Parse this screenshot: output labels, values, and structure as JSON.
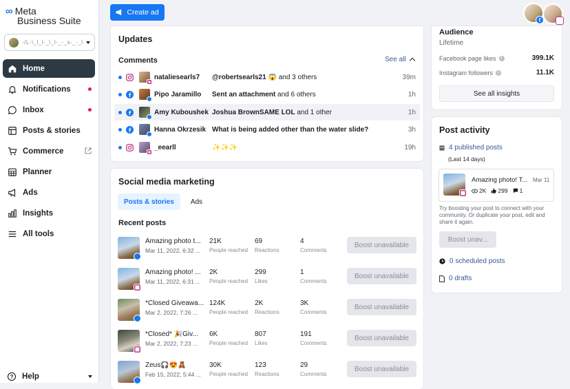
{
  "app": {
    "brand": "Meta",
    "product": "Business Suite"
  },
  "account": {
    "name": "-/L-\\_l_l-_\\_l-_-_s-_-_l-_l-_-_s"
  },
  "nav": {
    "items": [
      {
        "label": "Home",
        "icon": "home-icon",
        "active": true
      },
      {
        "label": "Notifications",
        "icon": "bell-icon",
        "dot": true
      },
      {
        "label": "Inbox",
        "icon": "chat-icon",
        "dot": true
      },
      {
        "label": "Posts & stories",
        "icon": "posts-icon"
      },
      {
        "label": "Commerce",
        "icon": "cart-icon",
        "external": true
      },
      {
        "label": "Planner",
        "icon": "calendar-icon"
      },
      {
        "label": "Ads",
        "icon": "megaphone-icon"
      },
      {
        "label": "Insights",
        "icon": "bar-chart-icon"
      },
      {
        "label": "All tools",
        "icon": "menu-icon"
      }
    ],
    "help": "Help"
  },
  "toolbar": {
    "create_ad": "Create ad"
  },
  "updates": {
    "title": "Updates",
    "comments_label": "Comments",
    "see_all": "See all",
    "comments": [
      {
        "platform": "instagram",
        "name": "nataliesearls7",
        "bold": "@robertsearls21 😱",
        "rest": " and 3 others",
        "time": "39m"
      },
      {
        "platform": "facebook",
        "name": "Pipo Jaramillo",
        "bold": "Sent an attachment",
        "rest": " and 6 others",
        "time": "1h"
      },
      {
        "platform": "facebook",
        "name": "Amy Kuboushek",
        "bold": "Joshua BrownSAME LOL",
        "rest": " and 1 other",
        "time": "1h"
      },
      {
        "platform": "facebook",
        "name": "Hanna Okrzesik",
        "bold": "What is being added other than the water slide?",
        "rest": "",
        "time": "3h"
      },
      {
        "platform": "instagram",
        "name": "_eearll",
        "bold": "",
        "rest": "✨✨✨",
        "time": "19h"
      }
    ]
  },
  "smm": {
    "title": "Social media marketing",
    "tabs": [
      "Posts & stories",
      "Ads"
    ],
    "recent_label": "Recent posts",
    "boost_label": "Boost unavailable",
    "posts": [
      {
        "platform": "facebook",
        "title": "Amazing photo t...",
        "date": "Mar 11, 2022, 6:32 ...",
        "m1": "21K",
        "l1": "People reached",
        "m2": "69",
        "l2": "Reactions",
        "m3": "4",
        "l3": "Comments"
      },
      {
        "platform": "instagram",
        "title": "Amazing photo! ...",
        "date": "Mar 11, 2022, 6:31 ...",
        "m1": "2K",
        "l1": "People reached",
        "m2": "299",
        "l2": "Likes",
        "m3": "1",
        "l3": "Comments"
      },
      {
        "platform": "facebook",
        "title": "*Closed Giveawa...",
        "date": "Mar 2, 2022, 7:26 ...",
        "m1": "124K",
        "l1": "People reached",
        "m2": "2K",
        "l2": "Reactions",
        "m3": "3K",
        "l3": "Comments"
      },
      {
        "platform": "instagram",
        "title": "*Closed* 🎉Giv...",
        "date": "Mar 2, 2022, 7:23 ...",
        "m1": "6K",
        "l1": "People reached",
        "m2": "807",
        "l2": "Likes",
        "m3": "191",
        "l3": "Comments"
      },
      {
        "platform": "facebook",
        "title": "Zeus🎧😍🧸",
        "date": "Feb 15, 2022, 5:44 ...",
        "m1": "30K",
        "l1": "People reached",
        "m2": "123",
        "l2": "Reactions",
        "m3": "29",
        "l3": "Comments"
      }
    ]
  },
  "audience": {
    "title": "Audience",
    "subtitle": "Lifetime",
    "fb_label": "Facebook page likes",
    "fb_value": "399.1K",
    "ig_label": "Instagram followers",
    "ig_value": "11.1K",
    "see_insights": "See all insights"
  },
  "post_activity": {
    "title": "Post activity",
    "published": "4 published posts",
    "period": "(Last 14 days)",
    "mini_post": {
      "title": "Amazing photo! T...",
      "date": "Mar 11",
      "reach": "2K",
      "likes": "299",
      "comments": "1"
    },
    "desc": "Try boosting your post to connect with your community. Or duplicate your post, edit and share it again.",
    "boost": "Boost unav...",
    "scheduled": "0 scheduled posts",
    "drafts": "0 drafts"
  },
  "colors": {
    "accent": "#1877f2",
    "nav_active": "#2d3a43",
    "link": "#385898",
    "instagram": "#c13584",
    "alert": "#e41e3f"
  }
}
